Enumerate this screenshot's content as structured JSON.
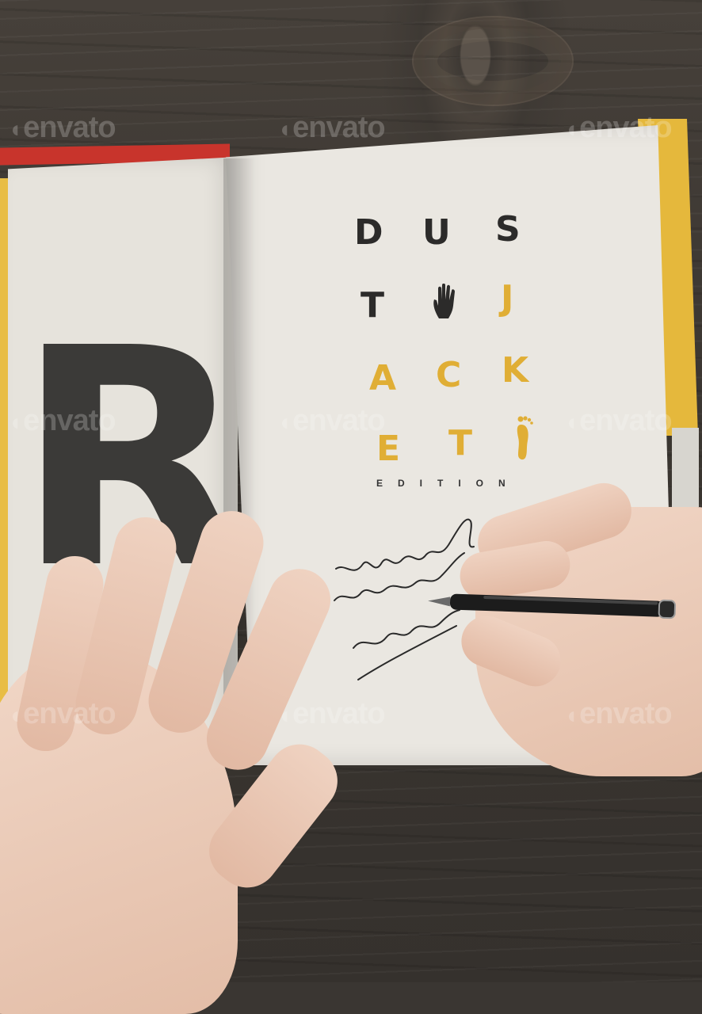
{
  "scene": {
    "description_role": "photo mockup of an open hardcover book on a wooden table being signed",
    "cover_colors": {
      "red": "#c8342c",
      "yellow": "#e8bd45",
      "dark": "#3b3a38"
    }
  },
  "left_page": {
    "big_letter": "R"
  },
  "title": {
    "row1": [
      "D",
      "U",
      "S"
    ],
    "row2": [
      "T",
      "J"
    ],
    "row3": [
      "A",
      "C",
      "K"
    ],
    "row4": [
      "E",
      "T"
    ],
    "edition": "EDITION",
    "icons": [
      "hand-icon",
      "foot-icon"
    ]
  },
  "watermarks": [
    "envato",
    "envato",
    "envato",
    "envato",
    "envato",
    "envato",
    "envato",
    "envato",
    "envato"
  ],
  "signature": {
    "lines": 4
  },
  "accent_colors": {
    "title_dark": "#2c2b2a",
    "title_yellow": "#e0ae35"
  }
}
